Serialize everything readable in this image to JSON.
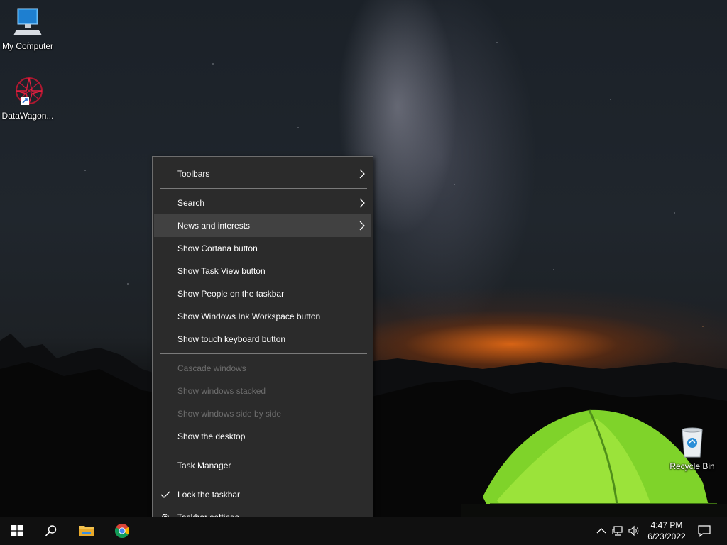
{
  "desktop": {
    "icons": [
      {
        "label": "My Computer"
      },
      {
        "label": "DataWagon..."
      },
      {
        "label": "Recycle Bin"
      }
    ]
  },
  "context_menu": {
    "items": [
      {
        "label": "Toolbars",
        "submenu": true
      },
      {
        "label": "Search",
        "submenu": true
      },
      {
        "label": "News and interests",
        "submenu": true,
        "highlighted": true
      },
      {
        "label": "Show Cortana button"
      },
      {
        "label": "Show Task View button"
      },
      {
        "label": "Show People on the taskbar"
      },
      {
        "label": "Show Windows Ink Workspace button"
      },
      {
        "label": "Show touch keyboard button"
      },
      {
        "label": "Cascade windows",
        "disabled": true
      },
      {
        "label": "Show windows stacked",
        "disabled": true
      },
      {
        "label": "Show windows side by side",
        "disabled": true
      },
      {
        "label": "Show the desktop"
      },
      {
        "label": "Task Manager"
      },
      {
        "label": "Lock the taskbar",
        "checked": true
      },
      {
        "label": "Taskbar settings",
        "icon": "gear-icon"
      }
    ]
  },
  "taskbar": {
    "time": "4:47 PM",
    "date": "6/23/2022"
  },
  "colors": {
    "menu_bg": "#2b2b2b",
    "menu_hover": "#414141",
    "menu_disabled_text": "#6d6d6d",
    "taskbar_bg": "#101010"
  }
}
